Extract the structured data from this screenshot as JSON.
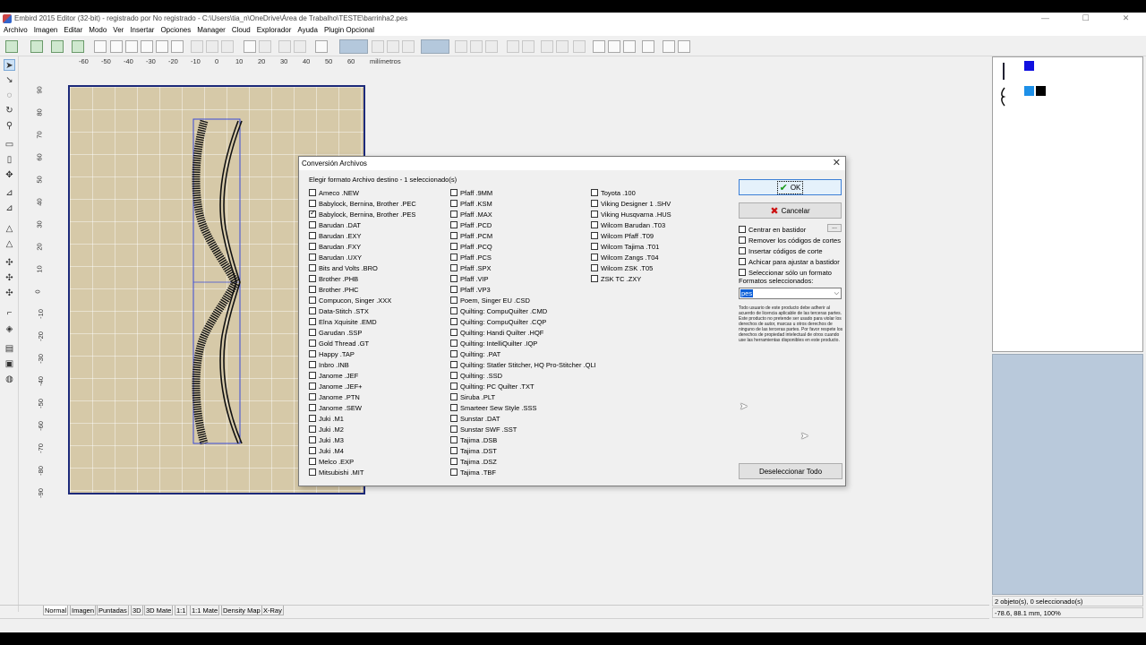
{
  "window": {
    "title": "Embird 2015 Editor (32-bit) - registrado por No registrado - C:\\Users\\tia_n\\OneDrive\\Área de Trabalho\\TESTE\\barrinha2.pes",
    "min": "—",
    "max": "☐",
    "close": "✕"
  },
  "menu": [
    "Archivo",
    "Imagen",
    "Editar",
    "Modo",
    "Ver",
    "Insertar",
    "Opciones",
    "Manager",
    "Cloud",
    "Explorador",
    "Ayuda",
    "Plugin Opcional"
  ],
  "ruler": {
    "h_labels": [
      "-60",
      "-50",
      "-40",
      "-30",
      "-20",
      "-10",
      "0",
      "10",
      "20",
      "30",
      "40",
      "50",
      "60"
    ],
    "unit": "milímetros",
    "v_labels": [
      "90",
      "80",
      "70",
      "60",
      "50",
      "40",
      "30",
      "20",
      "10",
      "0",
      "-10",
      "-20",
      "-30",
      "-40",
      "-50",
      "-60",
      "-70",
      "-80",
      "-90"
    ]
  },
  "tabs": [
    "Normal",
    "Imagen",
    "Puntadas",
    "3D",
    "3D Mate",
    "1:1",
    "1:1 Mate",
    "Density Map",
    "X-Ray"
  ],
  "status": {
    "objects": "2 objeto(s), 0 seleccionado(s)",
    "coords": "-78.6, 88.1 mm, 100%"
  },
  "colors": {
    "swatch1": "#1010e0",
    "swatch2": "#1e90e8",
    "swatch3": "#000000",
    "canvas_bg": "#d6c9a8",
    "canvas_border": "#1d2a7a"
  },
  "dialog": {
    "title": "Conversión Archivos",
    "close": "✕",
    "prompt": "Elegir formato Archivo destino - 1 seleccionado(s)",
    "col1": [
      {
        "label": "Ameco .NEW",
        "checked": false
      },
      {
        "label": "Babylock, Bernina, Brother .PEC",
        "checked": false
      },
      {
        "label": "Babylock, Bernina, Brother .PES",
        "checked": true
      },
      {
        "label": "Barudan .DAT",
        "checked": false
      },
      {
        "label": "Barudan .EXY",
        "checked": false
      },
      {
        "label": "Barudan .FXY",
        "checked": false
      },
      {
        "label": "Barudan .UXY",
        "checked": false
      },
      {
        "label": "Bits and Volts .BRO",
        "checked": false
      },
      {
        "label": "Brother .PHB",
        "checked": false
      },
      {
        "label": "Brother .PHC",
        "checked": false
      },
      {
        "label": "Compucon, Singer .XXX",
        "checked": false
      },
      {
        "label": "Data-Stitch .STX",
        "checked": false
      },
      {
        "label": "Elna Xquisite .EMD",
        "checked": false
      },
      {
        "label": "Garudan .SSP",
        "checked": false
      },
      {
        "label": "Gold Thread .GT",
        "checked": false
      },
      {
        "label": "Happy .TAP",
        "checked": false
      },
      {
        "label": "Inbro .INB",
        "checked": false
      },
      {
        "label": "Janome .JEF",
        "checked": false
      },
      {
        "label": "Janome .JEF+",
        "checked": false
      },
      {
        "label": "Janome .PTN",
        "checked": false
      },
      {
        "label": "Janome .SEW",
        "checked": false
      },
      {
        "label": "Juki .M1",
        "checked": false
      },
      {
        "label": "Juki .M2",
        "checked": false
      },
      {
        "label": "Juki .M3",
        "checked": false
      },
      {
        "label": "Juki .M4",
        "checked": false
      },
      {
        "label": "Melco .EXP",
        "checked": false
      },
      {
        "label": "Mitsubishi .MIT",
        "checked": false
      }
    ],
    "col2": [
      {
        "label": "Pfaff .9MM",
        "checked": false
      },
      {
        "label": "Pfaff .KSM",
        "checked": false
      },
      {
        "label": "Pfaff .MAX",
        "checked": false
      },
      {
        "label": "Pfaff .PCD",
        "checked": false
      },
      {
        "label": "Pfaff .PCM",
        "checked": false
      },
      {
        "label": "Pfaff .PCQ",
        "checked": false
      },
      {
        "label": "Pfaff .PCS",
        "checked": false
      },
      {
        "label": "Pfaff .SPX",
        "checked": false
      },
      {
        "label": "Pfaff .VIP",
        "checked": false
      },
      {
        "label": "Pfaff .VP3",
        "checked": false
      },
      {
        "label": "Poem, Singer EU .CSD",
        "checked": false
      },
      {
        "label": "Quilting: CompuQuilter .CMD",
        "checked": false
      },
      {
        "label": "Quilting: CompuQuilter .CQP",
        "checked": false
      },
      {
        "label": "Quilting: Handi Quilter .HQF",
        "checked": false
      },
      {
        "label": "Quilting: IntelliQuilter .IQP",
        "checked": false
      },
      {
        "label": "Quilting: .PAT",
        "checked": false
      },
      {
        "label": "Quilting: Statler Stitcher, HQ Pro-Stitcher .QLI",
        "checked": false
      },
      {
        "label": "Quilting: .SSD",
        "checked": false
      },
      {
        "label": "Quilting: PC Quilter .TXT",
        "checked": false
      },
      {
        "label": "Siruba .PLT",
        "checked": false
      },
      {
        "label": "Smarteer Sew Style .SSS",
        "checked": false
      },
      {
        "label": "Sunstar .DAT",
        "checked": false
      },
      {
        "label": "Sunstar SWF .SST",
        "checked": false
      },
      {
        "label": "Tajima .DSB",
        "checked": false
      },
      {
        "label": "Tajima .DST",
        "checked": false
      },
      {
        "label": "Tajima .DSZ",
        "checked": false
      },
      {
        "label": "Tajima .TBF",
        "checked": false
      }
    ],
    "col3": [
      {
        "label": "Toyota .100",
        "checked": false
      },
      {
        "label": "Viking Designer 1 .SHV",
        "checked": false
      },
      {
        "label": "Viking Husqvarna .HUS",
        "checked": false
      },
      {
        "label": "Wilcom Barudan .T03",
        "checked": false
      },
      {
        "label": "Wilcom Pfaff .T09",
        "checked": false
      },
      {
        "label": "Wilcom Tajima .T01",
        "checked": false
      },
      {
        "label": "Wilcom Zangs .T04",
        "checked": false
      },
      {
        "label": "Wilcom ZSK .T05",
        "checked": false
      },
      {
        "label": "ZSK TC .ZXY",
        "checked": false
      }
    ],
    "ok": "OK",
    "cancel": "Cancelar",
    "dots": "...",
    "options": [
      {
        "label": "Centrar en bastidor",
        "checked": false
      },
      {
        "label": "Remover los códigos de cortes",
        "checked": false
      },
      {
        "label": "Insertar códigos de corte",
        "checked": false
      },
      {
        "label": "Achicar para ajustar a bastidor",
        "checked": false
      },
      {
        "label": "Seleccionar sólo un formato",
        "checked": false
      }
    ],
    "formats_label": "Formatos seleccionados:",
    "formats_value": "pes",
    "license_text": "Todo usuario de este producto debe adherir al acuerdo de licencia aplicable de las terceras partes. Este producto no pretende ser usado para violar los derechos de autor, marcas u otros derechos de ninguno de las terceras partes. Por favor respete los derechos de propiedad intelectual de otros cuando use las herramientas disponibles en este producto.",
    "deselect_all": "Deseleccionar Todo"
  }
}
